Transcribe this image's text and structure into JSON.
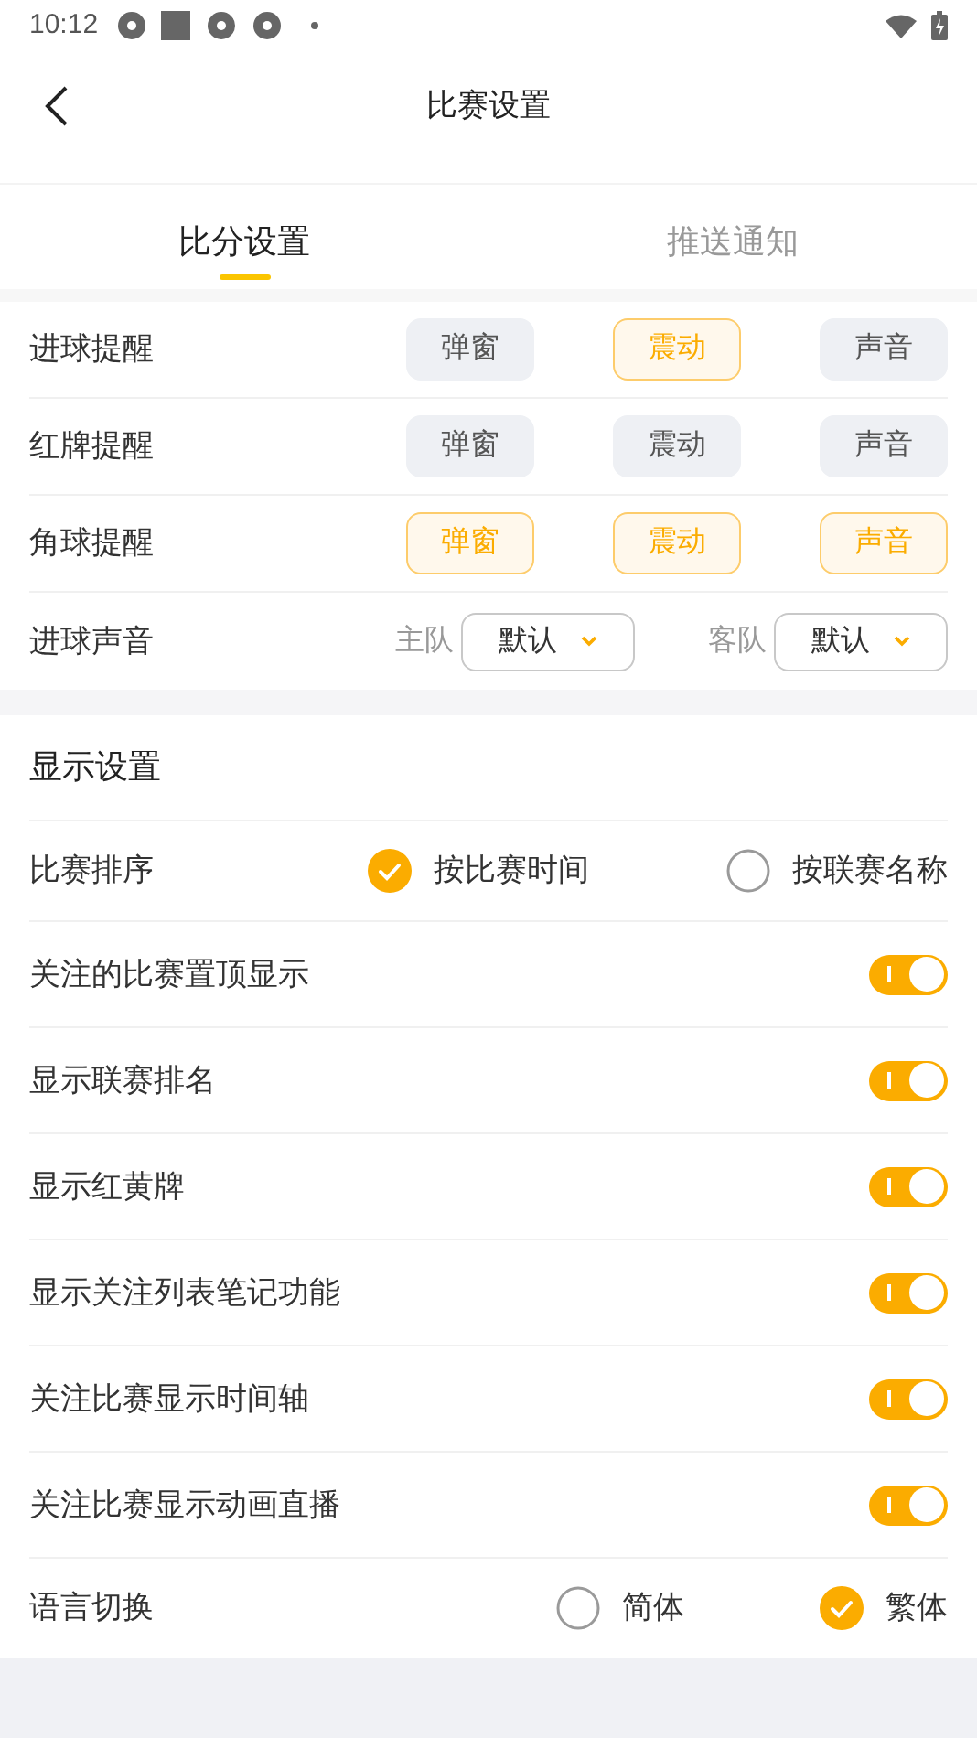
{
  "status_bar": {
    "time": "10:12"
  },
  "header": {
    "title": "比赛设置"
  },
  "tabs": [
    {
      "label": "比分设置",
      "selected": true
    },
    {
      "label": "推送通知",
      "selected": false
    }
  ],
  "alerts": [
    {
      "label": "进球提醒",
      "options": [
        {
          "label": "弹窗",
          "selected": false
        },
        {
          "label": "震动",
          "selected": true
        },
        {
          "label": "声音",
          "selected": false
        }
      ]
    },
    {
      "label": "红牌提醒",
      "options": [
        {
          "label": "弹窗",
          "selected": false
        },
        {
          "label": "震动",
          "selected": false
        },
        {
          "label": "声音",
          "selected": false
        }
      ]
    },
    {
      "label": "角球提醒",
      "options": [
        {
          "label": "弹窗",
          "selected": true
        },
        {
          "label": "震动",
          "selected": true
        },
        {
          "label": "声音",
          "selected": true
        }
      ]
    }
  ],
  "goal_sound": {
    "label": "进球声音",
    "home": {
      "label": "主队",
      "value": "默认"
    },
    "away": {
      "label": "客队",
      "value": "默认"
    }
  },
  "display": {
    "title": "显示设置",
    "sort": {
      "label": "比赛排序",
      "options": [
        {
          "label": "按比赛时间",
          "selected": true
        },
        {
          "label": "按联赛名称",
          "selected": false
        }
      ]
    },
    "toggles": [
      {
        "label": "关注的比赛置顶显示",
        "on": true
      },
      {
        "label": "显示联赛排名",
        "on": true
      },
      {
        "label": "显示红黄牌",
        "on": true
      },
      {
        "label": "显示关注列表笔记功能",
        "on": true
      },
      {
        "label": "关注比赛显示时间轴",
        "on": true
      },
      {
        "label": "关注比赛显示动画直播",
        "on": true
      }
    ],
    "language": {
      "label": "语言切换",
      "options": [
        {
          "label": "简体",
          "selected": false
        },
        {
          "label": "繁体",
          "selected": true
        }
      ]
    }
  }
}
